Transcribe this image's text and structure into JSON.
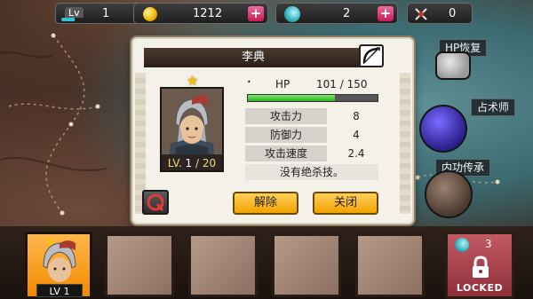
{
  "topbar": {
    "level_label": "Lv",
    "level_value": "1",
    "level_progress": 0.15,
    "gold_amount": "1212",
    "gem_amount": "2",
    "troop_amount": "0",
    "plus_symbol": "+"
  },
  "dialog": {
    "title": "李典",
    "star": "★",
    "hp_label": "HP",
    "hp_value": "101 / 150",
    "hp_fraction": 0.673,
    "hp_bullet": "•",
    "level_prefix": "LV.",
    "level_current": "1",
    "level_max": "/ 20",
    "stats": [
      {
        "label": "攻击力",
        "value": "8"
      },
      {
        "label": "防御力",
        "value": "4"
      },
      {
        "label": "攻击速度",
        "value": "2.4"
      }
    ],
    "skill_text": "没有绝杀技。",
    "dismiss_button": "解除",
    "close_button": "关闭"
  },
  "right_menu": {
    "hp_restore": "HP恢复",
    "fortune_teller": "占术师",
    "inner_power": "内功传承"
  },
  "bottombar": {
    "active_hero_level": "LV 1",
    "locked_label": "LOCKED",
    "locked_count": "3"
  },
  "colors": {
    "accent_orange": "#f2a300",
    "hp_green": "#2fae2a",
    "locked_red": "#8f2f3a",
    "cyan": "#35c4cf"
  }
}
